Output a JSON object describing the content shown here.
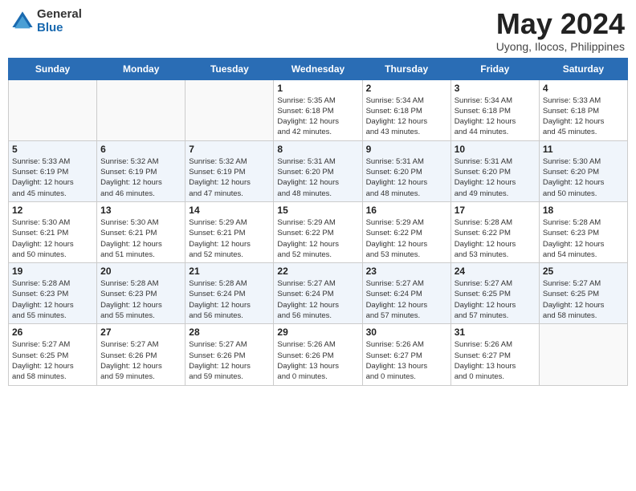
{
  "logo": {
    "general": "General",
    "blue": "Blue"
  },
  "title": {
    "month": "May 2024",
    "location": "Uyong, Ilocos, Philippines"
  },
  "weekdays": [
    "Sunday",
    "Monday",
    "Tuesday",
    "Wednesday",
    "Thursday",
    "Friday",
    "Saturday"
  ],
  "weeks": [
    [
      {
        "day": "",
        "info": ""
      },
      {
        "day": "",
        "info": ""
      },
      {
        "day": "",
        "info": ""
      },
      {
        "day": "1",
        "info": "Sunrise: 5:35 AM\nSunset: 6:18 PM\nDaylight: 12 hours\nand 42 minutes."
      },
      {
        "day": "2",
        "info": "Sunrise: 5:34 AM\nSunset: 6:18 PM\nDaylight: 12 hours\nand 43 minutes."
      },
      {
        "day": "3",
        "info": "Sunrise: 5:34 AM\nSunset: 6:18 PM\nDaylight: 12 hours\nand 44 minutes."
      },
      {
        "day": "4",
        "info": "Sunrise: 5:33 AM\nSunset: 6:18 PM\nDaylight: 12 hours\nand 45 minutes."
      }
    ],
    [
      {
        "day": "5",
        "info": "Sunrise: 5:33 AM\nSunset: 6:19 PM\nDaylight: 12 hours\nand 45 minutes."
      },
      {
        "day": "6",
        "info": "Sunrise: 5:32 AM\nSunset: 6:19 PM\nDaylight: 12 hours\nand 46 minutes."
      },
      {
        "day": "7",
        "info": "Sunrise: 5:32 AM\nSunset: 6:19 PM\nDaylight: 12 hours\nand 47 minutes."
      },
      {
        "day": "8",
        "info": "Sunrise: 5:31 AM\nSunset: 6:20 PM\nDaylight: 12 hours\nand 48 minutes."
      },
      {
        "day": "9",
        "info": "Sunrise: 5:31 AM\nSunset: 6:20 PM\nDaylight: 12 hours\nand 48 minutes."
      },
      {
        "day": "10",
        "info": "Sunrise: 5:31 AM\nSunset: 6:20 PM\nDaylight: 12 hours\nand 49 minutes."
      },
      {
        "day": "11",
        "info": "Sunrise: 5:30 AM\nSunset: 6:20 PM\nDaylight: 12 hours\nand 50 minutes."
      }
    ],
    [
      {
        "day": "12",
        "info": "Sunrise: 5:30 AM\nSunset: 6:21 PM\nDaylight: 12 hours\nand 50 minutes."
      },
      {
        "day": "13",
        "info": "Sunrise: 5:30 AM\nSunset: 6:21 PM\nDaylight: 12 hours\nand 51 minutes."
      },
      {
        "day": "14",
        "info": "Sunrise: 5:29 AM\nSunset: 6:21 PM\nDaylight: 12 hours\nand 52 minutes."
      },
      {
        "day": "15",
        "info": "Sunrise: 5:29 AM\nSunset: 6:22 PM\nDaylight: 12 hours\nand 52 minutes."
      },
      {
        "day": "16",
        "info": "Sunrise: 5:29 AM\nSunset: 6:22 PM\nDaylight: 12 hours\nand 53 minutes."
      },
      {
        "day": "17",
        "info": "Sunrise: 5:28 AM\nSunset: 6:22 PM\nDaylight: 12 hours\nand 53 minutes."
      },
      {
        "day": "18",
        "info": "Sunrise: 5:28 AM\nSunset: 6:23 PM\nDaylight: 12 hours\nand 54 minutes."
      }
    ],
    [
      {
        "day": "19",
        "info": "Sunrise: 5:28 AM\nSunset: 6:23 PM\nDaylight: 12 hours\nand 55 minutes."
      },
      {
        "day": "20",
        "info": "Sunrise: 5:28 AM\nSunset: 6:23 PM\nDaylight: 12 hours\nand 55 minutes."
      },
      {
        "day": "21",
        "info": "Sunrise: 5:28 AM\nSunset: 6:24 PM\nDaylight: 12 hours\nand 56 minutes."
      },
      {
        "day": "22",
        "info": "Sunrise: 5:27 AM\nSunset: 6:24 PM\nDaylight: 12 hours\nand 56 minutes."
      },
      {
        "day": "23",
        "info": "Sunrise: 5:27 AM\nSunset: 6:24 PM\nDaylight: 12 hours\nand 57 minutes."
      },
      {
        "day": "24",
        "info": "Sunrise: 5:27 AM\nSunset: 6:25 PM\nDaylight: 12 hours\nand 57 minutes."
      },
      {
        "day": "25",
        "info": "Sunrise: 5:27 AM\nSunset: 6:25 PM\nDaylight: 12 hours\nand 58 minutes."
      }
    ],
    [
      {
        "day": "26",
        "info": "Sunrise: 5:27 AM\nSunset: 6:25 PM\nDaylight: 12 hours\nand 58 minutes."
      },
      {
        "day": "27",
        "info": "Sunrise: 5:27 AM\nSunset: 6:26 PM\nDaylight: 12 hours\nand 59 minutes."
      },
      {
        "day": "28",
        "info": "Sunrise: 5:27 AM\nSunset: 6:26 PM\nDaylight: 12 hours\nand 59 minutes."
      },
      {
        "day": "29",
        "info": "Sunrise: 5:26 AM\nSunset: 6:26 PM\nDaylight: 13 hours\nand 0 minutes."
      },
      {
        "day": "30",
        "info": "Sunrise: 5:26 AM\nSunset: 6:27 PM\nDaylight: 13 hours\nand 0 minutes."
      },
      {
        "day": "31",
        "info": "Sunrise: 5:26 AM\nSunset: 6:27 PM\nDaylight: 13 hours\nand 0 minutes."
      },
      {
        "day": "",
        "info": ""
      }
    ]
  ]
}
